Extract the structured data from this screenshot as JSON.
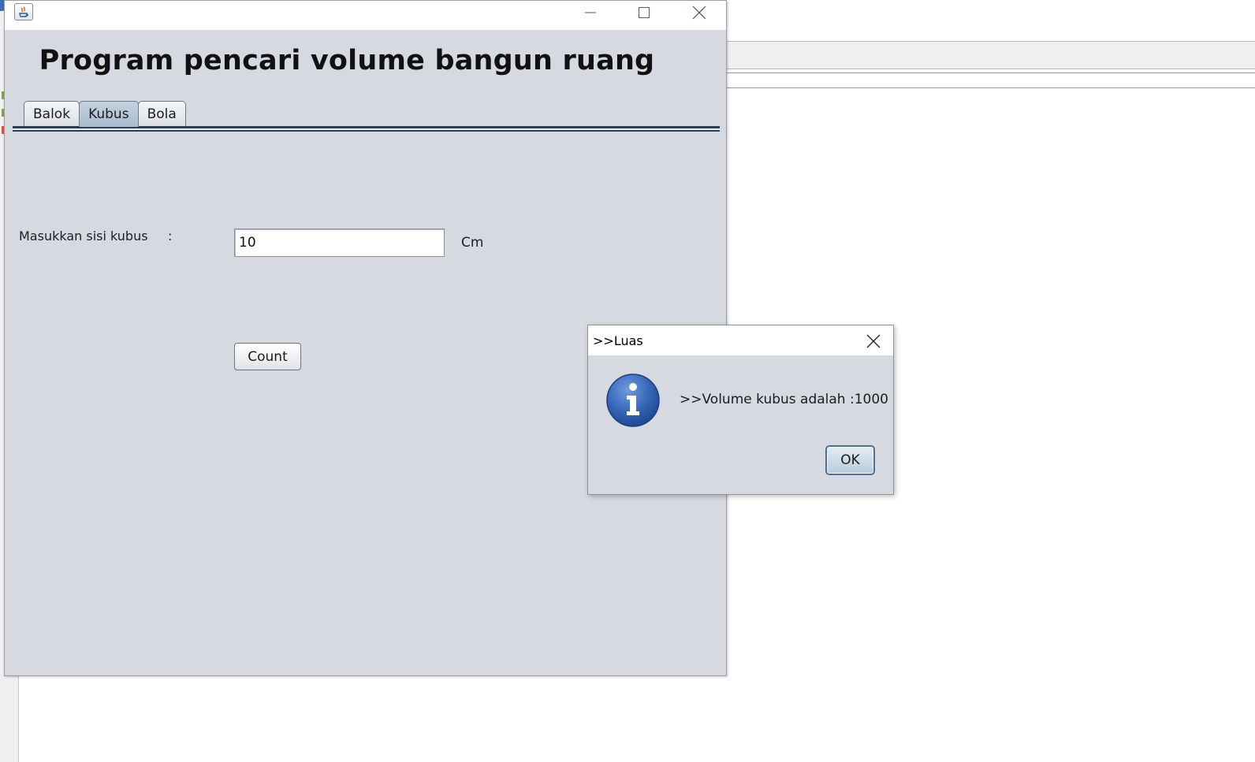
{
  "window": {
    "title": "",
    "app_title": "Program pencari volume bangun ruang"
  },
  "tabs": [
    {
      "label": "Balok",
      "active": false
    },
    {
      "label": "Kubus",
      "active": true
    },
    {
      "label": "Bola",
      "active": false
    }
  ],
  "form": {
    "label": "Masukkan sisi kubus",
    "colon": ":",
    "value": "10",
    "unit": "Cm",
    "button_label": "Count"
  },
  "dialog": {
    "title": ">>Luas",
    "message": ">>Volume kubus adalah :1000",
    "ok_label": "OK",
    "icon": "info-icon"
  },
  "colors": {
    "window_bg": "#d6d9df",
    "active_tab": "#b3c4d4",
    "tab_rule": "#2c3c5a",
    "info_blue": "#2f5fa8"
  }
}
